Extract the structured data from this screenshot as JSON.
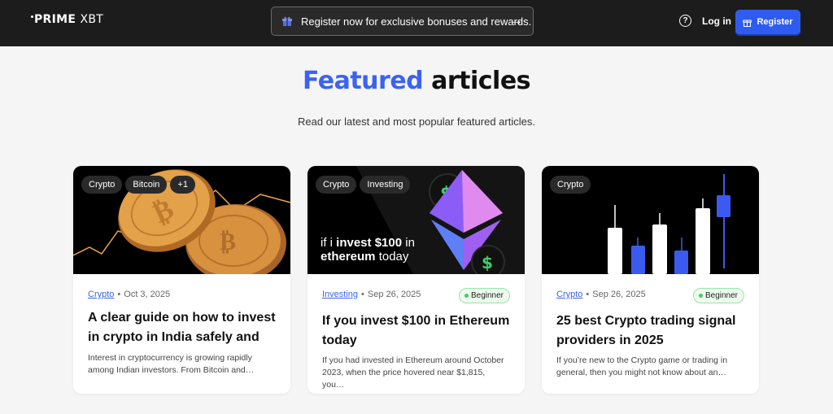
{
  "header": {
    "logo_prime": "PRIME",
    "logo_xbt": "XBT",
    "promo_text": "Register now for exclusive bonuses and rewards.",
    "help_icon": "?",
    "login_label": "Log in",
    "register_label": "Register"
  },
  "section": {
    "title_accent": "Featured",
    "title_rest": "articles",
    "subtitle": "Read our latest and most popular featured articles."
  },
  "cards": [
    {
      "tags": [
        "Crypto",
        "Bitcoin",
        "+1"
      ],
      "category": "Crypto",
      "date": "Oct 3, 2025",
      "title": "A clear guide on how to invest in crypto in India safely and",
      "description": "Interest in cryptocurrency is growing rapidly among Indian investors. From Bitcoin and…"
    },
    {
      "tags": [
        "Crypto",
        "Investing"
      ],
      "image_text_1": "if i",
      "image_text_bold": "invest $100",
      "image_text_2": "in",
      "image_text_3": "ethereum",
      "image_text_4": "today",
      "category": "Investing",
      "date": "Sep 26, 2025",
      "badge": "Beginner",
      "title": "If you invest $100 in Ethereum today",
      "description": "If you had invested in Ethereum around October 2023, when the price hovered near $1,815, you…"
    },
    {
      "tags": [
        "Crypto"
      ],
      "category": "Crypto",
      "date": "Sep 26, 2025",
      "badge": "Beginner",
      "title": "25 best Crypto trading signal providers in 2025",
      "description": "If you’re new to the Crypto game or trading in general, then you might not know about an…"
    }
  ],
  "colors": {
    "accent": "#3a63f3",
    "header_bg": "#1c1c1c",
    "badge_green": "#4bc765"
  }
}
